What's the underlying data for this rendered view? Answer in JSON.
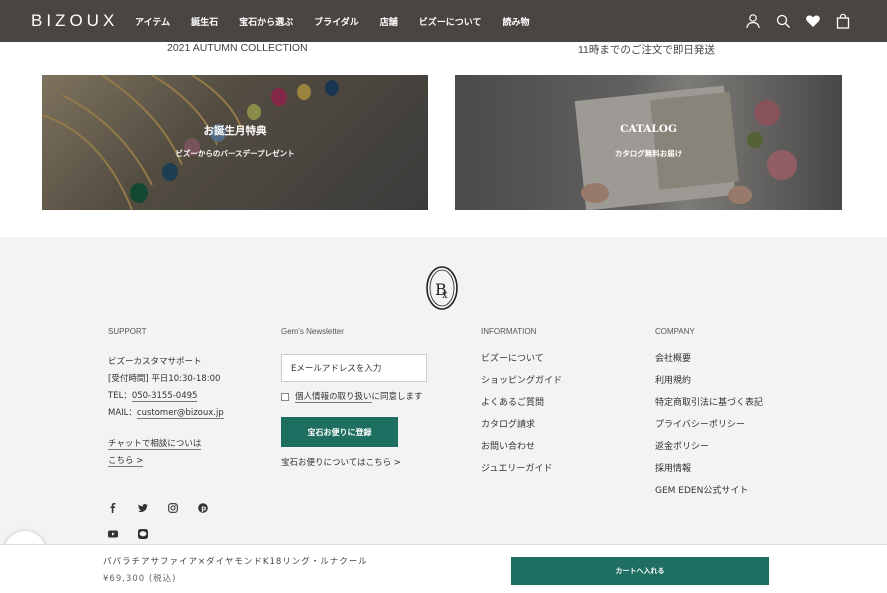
{
  "header": {
    "logo": "BIZOUX",
    "nav": [
      "アイテム",
      "誕生石",
      "宝石から選ぶ",
      "ブライダル",
      "店舗",
      "ビズーについて",
      "読み物"
    ],
    "icons": [
      "user-icon",
      "search-icon",
      "heart-icon",
      "bag-icon"
    ]
  },
  "top": {
    "caption_left": "2021 AUTUMN COLLECTION",
    "caption_right": "11時までのご注文で即日発送",
    "banner_left": {
      "title": "お誕生月特典",
      "subtitle": "ビズーからのバースデープレゼント"
    },
    "banner_right": {
      "title": "CATALOG",
      "subtitle": "カタログ無料お届け"
    }
  },
  "footer": {
    "support": {
      "heading": "SUPPORT",
      "name": "ビズーカスタマサポート",
      "hours": "[受付時間] 平日10:30-18:00",
      "tel_label": "TEL：",
      "tel": "050-3155-0495",
      "mail_label": "MAIL：",
      "mail": "customer@bizoux.jp",
      "chat_link_1": "チャットで相談についは",
      "chat_link_2": "こちら >"
    },
    "newsletter": {
      "heading": "Gem's Newsletter",
      "placeholder": "Eメールアドレスを入力",
      "consent_link": "個人情報の取り扱い",
      "consent_rest": "に同意します",
      "register": "宝石お便りに登録",
      "about_link": "宝石お便りについてはこちら >"
    },
    "information": {
      "heading": "INFORMATION",
      "links": [
        "ビズーについて",
        "ショッピングガイド",
        "よくあるご質問",
        "カタログ請求",
        "お問い合わせ",
        "ジュエリーガイド"
      ]
    },
    "company": {
      "heading": "COMPANY",
      "links": [
        "会社概要",
        "利用規約",
        "特定商取引法に基づく表記",
        "プライバシーポリシー",
        "返金ポリシー",
        "採用情報",
        "GEM EDEN公式サイト"
      ]
    }
  },
  "bottom_bar": {
    "product_name": "パパラチアサファイア×ダイヤモンドK18リング・ルナクール",
    "price": "¥69,300 (税込)",
    "cart_button": "カートへ入れる"
  },
  "colors": {
    "header_bg": "#4a4542",
    "accent": "#1e6e62",
    "footer_bg": "#f3f3f3"
  }
}
